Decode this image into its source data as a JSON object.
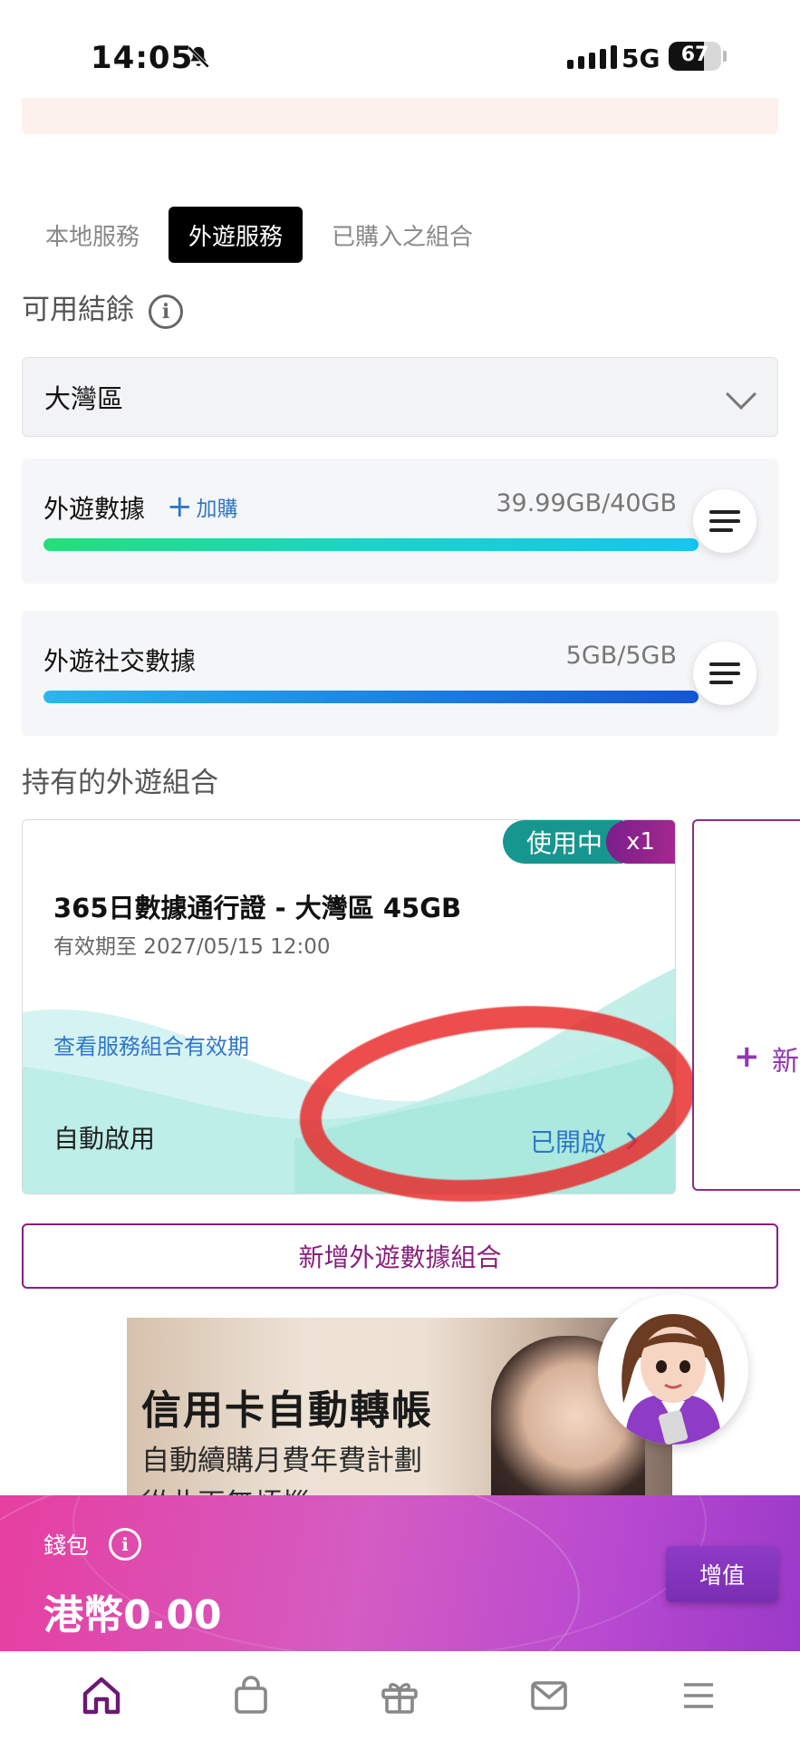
{
  "status_bar": {
    "time": "14:05",
    "network": "5G",
    "battery": "67"
  },
  "tabs": [
    {
      "label": "本地服務",
      "active": false
    },
    {
      "label": "外遊服務",
      "active": true
    },
    {
      "label": "已購入之組合",
      "active": false
    }
  ],
  "balance_section": {
    "title": "可用結餘",
    "info_icon": "info-icon"
  },
  "region_select": {
    "value": "大灣區"
  },
  "usage": [
    {
      "label": "外遊數據",
      "addon_label": "加購",
      "amount": "39.99GB/40GB",
      "remaining_fraction": 0.99975,
      "bar_colors": [
        "#22e07a",
        "#16d6c8",
        "#11c7f0"
      ]
    },
    {
      "label": "外遊社交數據",
      "amount": "5GB/5GB",
      "remaining_fraction": 1.0,
      "bar_colors": [
        "#2bb6ee",
        "#1d86e2",
        "#1256d6"
      ]
    }
  ],
  "bundles_section": {
    "title": "持有的外遊組合"
  },
  "bundle": {
    "status": "使用中",
    "count": "x1",
    "title": "365日數據通行證 - 大灣區 45GB",
    "expiry": "有效期至 2027/05/15 12:00",
    "view_validity_link": "查看服務組合有效期",
    "auto_activate_label": "自動啟用",
    "auto_activate_value": "已開啟"
  },
  "add_card": {
    "label": "新"
  },
  "add_bundle_button": "新增外遊數據組合",
  "banner": {
    "headline": "信用卡自動轉帳",
    "line1": "自動續購月費年費計劃",
    "line2": "從此再無煩惱"
  },
  "wallet": {
    "label": "錢包",
    "amount": "港幣0.00",
    "topup_label": "增值"
  },
  "bottom_nav": [
    "home-icon",
    "shopping-bag-icon",
    "gift-icon",
    "mail-icon",
    "menu-icon"
  ],
  "colors": {
    "accent_purple": "#8a1e7e",
    "link_blue": "#2f76c9",
    "teal_badge": "#17968f"
  }
}
